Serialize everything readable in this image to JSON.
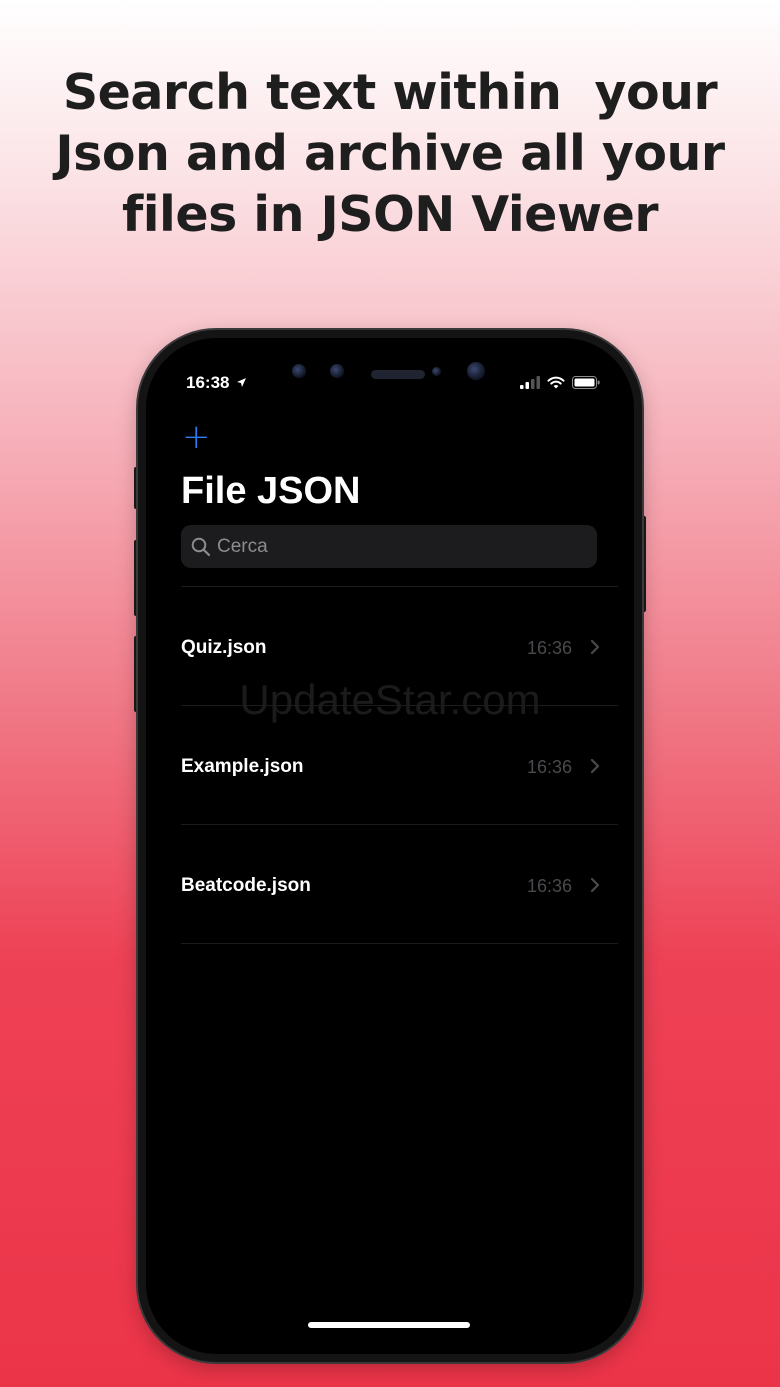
{
  "headline": {
    "line1": "Search text within  your",
    "line2": "Json and archive all your",
    "line3": "files in JSON Viewer"
  },
  "status": {
    "time": "16:38"
  },
  "app": {
    "add_label": "+",
    "title": "File JSON",
    "search_placeholder": "Cerca"
  },
  "files": [
    {
      "name": "Quiz.json",
      "time": "16:36"
    },
    {
      "name": "Example.json",
      "time": "16:36"
    },
    {
      "name": "Beatcode.json",
      "time": "16:36"
    }
  ],
  "watermark": "UpdateStar.com",
  "colors": {
    "accent": "#2f7bf6",
    "background_bottom": "#ec3448",
    "screen": "#000000"
  }
}
